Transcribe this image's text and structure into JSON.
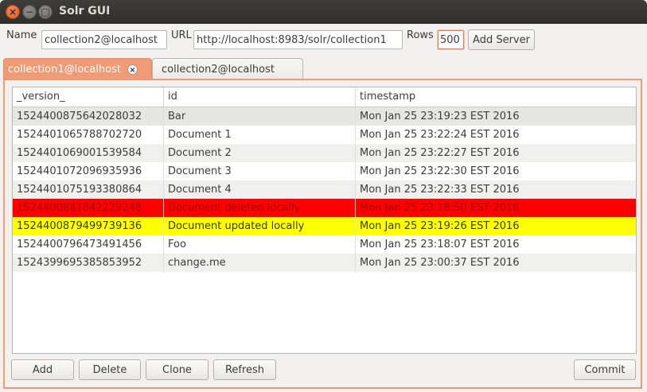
{
  "window": {
    "title": "Solr GUI",
    "close_glyph": "×",
    "minimize_glyph": "−",
    "maximize_glyph": "□"
  },
  "toolbar": {
    "name_label": "Name",
    "name_value": "collection2@localhost",
    "url_label": "URL",
    "url_value": "http://localhost:8983/solr/collection1",
    "rows_label": "Rows",
    "rows_value": "500",
    "add_server_label": "Add Server"
  },
  "tabs": [
    {
      "label": "collection1@localhost",
      "active": true,
      "close_glyph": "×"
    },
    {
      "label": "collection2@localhost",
      "active": false
    }
  ],
  "table": {
    "columns": [
      "_version_",
      "id",
      "timestamp"
    ],
    "rows": [
      {
        "version": "1524400875642028032",
        "id": "Bar",
        "timestamp": "Mon Jan 25 23:19:23 EST 2016",
        "status": "selected"
      },
      {
        "version": "1524401065788702720",
        "id": "Document 1",
        "timestamp": "Mon Jan 25 23:22:24 EST 2016",
        "status": "normal"
      },
      {
        "version": "1524401069001539584",
        "id": "Document 2",
        "timestamp": "Mon Jan 25 23:22:27 EST 2016",
        "status": "normal"
      },
      {
        "version": "1524401072096935936",
        "id": "Document 3",
        "timestamp": "Mon Jan 25 23:22:30 EST 2016",
        "status": "normal"
      },
      {
        "version": "1524401075193380864",
        "id": "Document 4",
        "timestamp": "Mon Jan 25 23:22:33 EST 2016",
        "status": "normal"
      },
      {
        "version": "1524400841842229248",
        "id": "Document deleted locally",
        "timestamp": "Mon Jan 25 23:18:50 EST 2016",
        "status": "deleted"
      },
      {
        "version": "1524400879499739136",
        "id": "Document updated locally",
        "timestamp": "Mon Jan 25 23:19:26 EST 2016",
        "status": "updated"
      },
      {
        "version": "1524400796473491456",
        "id": "Foo",
        "timestamp": "Mon Jan 25 23:18:07 EST 2016",
        "status": "normal"
      },
      {
        "version": "1524399695385853952",
        "id": "change.me",
        "timestamp": "Mon Jan 25 23:00:37 EST 2016",
        "status": "normal"
      }
    ]
  },
  "actions": {
    "add": "Add",
    "delete": "Delete",
    "clone": "Clone",
    "refresh": "Refresh",
    "commit": "Commit"
  },
  "colors": {
    "accent": "#f19b76",
    "focus_border": "#f07746",
    "deleted_bg": "#ff0000",
    "deleted_text": "#9b0000",
    "updated_bg": "#ffff00",
    "updated_text": "#3c3c00",
    "selected_bg": "#e6e6e5",
    "stripe_bg": "#f0f0ef",
    "normal_bg": "#ffffff"
  }
}
